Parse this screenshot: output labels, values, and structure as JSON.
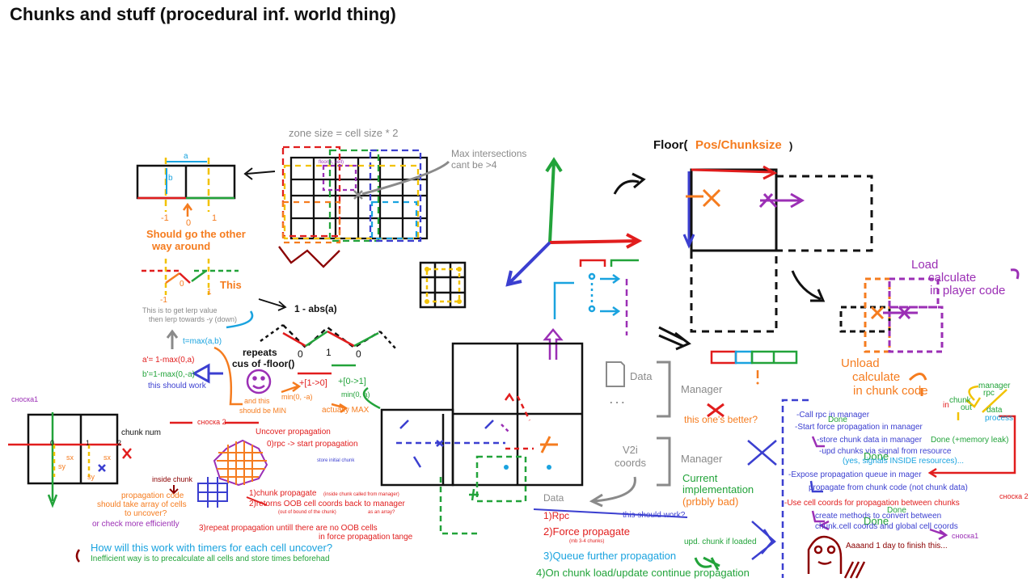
{
  "title": "Chunks and stuff (procedural inf. world thing)",
  "colors": {
    "red": "#e11d1d",
    "orange": "#f57c1f",
    "yellow": "#f2c200",
    "green": "#22a33a",
    "blue": "#3b3fd0",
    "cyan": "#1aa3df",
    "purple": "#9b2fb5",
    "gray": "#8a8a8a",
    "maroon": "#8b0000",
    "black": "#111111",
    "darkgreen": "#0f8a3a"
  },
  "grid_notes": {
    "zone_size": "zone size = cell size * 2",
    "floor_cell": "floor(x, cell)",
    "max_intersections": "Max intersections",
    "cant_be": "cant be >4",
    "a": "a",
    "b": "b",
    "neg1": "-1",
    "zero": "0",
    "one": "1",
    "should_go": "Should go the other",
    "way_around": "way around",
    "this": "This",
    "lerp_1": "This is to get lerp value",
    "lerp_2": "then lerp towards -y (down)",
    "one_minus_abs": "1 - abs(a)",
    "t_max": "t=max(a,b)",
    "a_prime": "a'=  1-max(0,a)",
    "b_prime": "b'=1-max(0,-a)",
    "this_should_work": "this should work",
    "repeats": "repeats",
    "cus_floor": "cus of -floor()",
    "wave_0a": "0",
    "wave_1": "1",
    "wave_0b": "0",
    "plus_1_0": "+[1->0]",
    "plus_0_1": "+[0->1]",
    "min_0_neg_a": "min(0, -a)",
    "min_0_a": "min(0, a)",
    "and_this_1": "and this",
    "and_this_2": "should be MIN",
    "actually_max": "actually MAX"
  },
  "chunk_notes": {
    "snoska1": "сноска1",
    "chunk_num": "chunk num",
    "zero": "0",
    "one": "1",
    "two": "2",
    "sx": "sx",
    "sy": "sy",
    "sx2": "sx",
    "sy2": "sy",
    "snoska2_label": "сноска 2",
    "uncover": "Uncover propagation",
    "rpc_start": "0)rpc -> start propagation",
    "store_initial": "store initial chunk",
    "inside_chunk": "inside chunk",
    "prop_code_1": "propagation code",
    "prop_code_2": "should take array of cells",
    "prop_code_3": "to uncover?",
    "or_check": "or check more efficiently",
    "step1": "1)chunk propagate",
    "step1_note": "(inside chunk called from manager)",
    "step2": "2)retorns OOB cell coords back to manager",
    "step2_note": "(out of bound of the chunk)",
    "as_array": "as an array?",
    "step3_1": "3)repeat propagation untill there are no OOB cells",
    "step3_2": "in force propagation tange",
    "timers_q": "How will this work with timers for each cell uncover?",
    "inefficient": "Inefficient way is to precalculate all cells and store times beforehad"
  },
  "floor_notes": {
    "floor_open": "Floor(",
    "pos_chunk": "Pos/Chunksize",
    "floor_close": ")",
    "load_1": "Load",
    "load_2": "calculate",
    "load_3": "in player code",
    "unload_1": "Unload",
    "unload_2": "calculate",
    "unload_3": "in chunk code"
  },
  "manager_notes": {
    "data": "Data",
    "dots": ". . .",
    "manager1": "Manager",
    "this_ones_better": "this one's better?",
    "v2i_1": "V2i",
    "v2i_2": "coords",
    "manager2": "Manager",
    "current_1": "Current",
    "current_2": "implementation",
    "current_3": "(prbbly bad)",
    "data2": "Data",
    "rpc": "1)Rpc",
    "force": "2)Force propagate",
    "force_note": "(mb 3-4 chunks)",
    "this_should_work": "this should work?",
    "queue": "3)Queue further propagation",
    "upd_chunk": "upd. chunk if loaded",
    "on_load": "4)On chunk load/update continue propagation"
  },
  "todo": {
    "manager": "manager",
    "rpc": "rpc",
    "in": "in",
    "chunk": "chunk",
    "out": "out",
    "data": "data",
    "process": "process",
    "call_rpc": "-Call rpc in manager",
    "done1": "Done",
    "start_force": "-Start force propagation in manager",
    "store_chunk": "-store chunk data in manager",
    "done_leak": "Done (+memory leak)",
    "upd_chunks": "-upd chunks via signal from resource",
    "done2": "Done",
    "signals_inside": "(yes, signals INSIDE resources)...",
    "expose": "-Expose propagation queue in mager",
    "propagate_from": "propagate from chunk code (not chunk data)",
    "snoska2": "сноска 2",
    "use_cell": "-Use cell coords for propagation between chunks",
    "done3": "Done",
    "create_methods": "create methods to convert between",
    "chunk_cell": "chunk.cell coords and global cell coords",
    "done4": "Done",
    "snoska1": "сноска1",
    "aaaand": "Aaaand 1 day to finish this..."
  }
}
